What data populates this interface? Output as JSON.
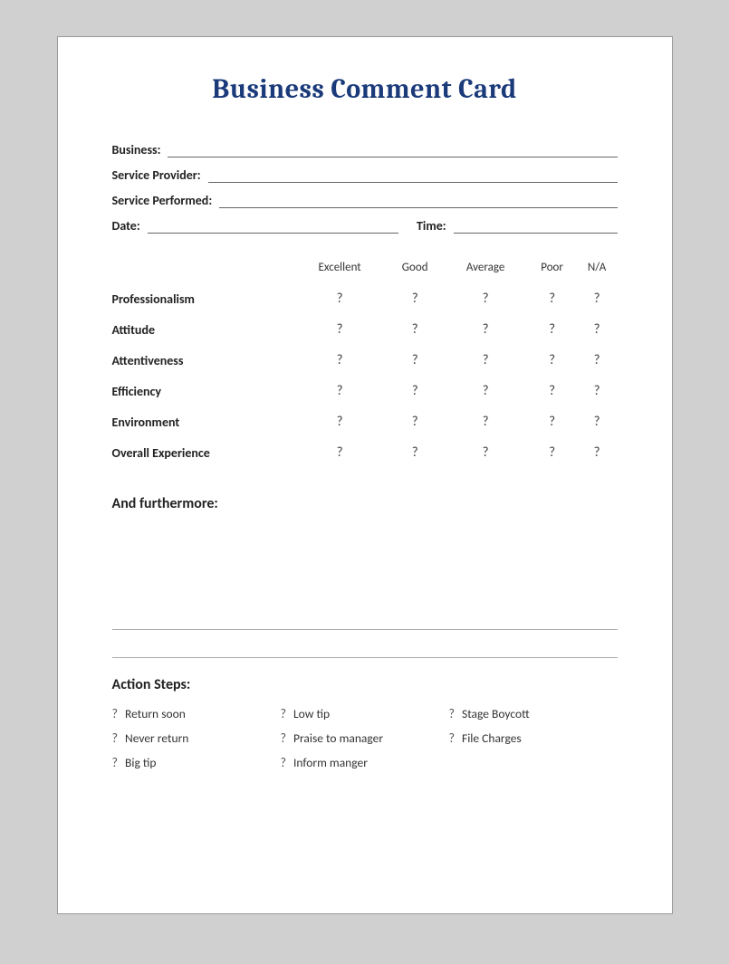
{
  "title": "Business Comment Card",
  "fields": {
    "business_label": "Business:",
    "service_provider_label": "Service Provider:",
    "service_performed_label": "Service Performed:",
    "date_label": "Date:",
    "time_label": "Time:"
  },
  "rating": {
    "columns": [
      "",
      "Excellent",
      "Good",
      "Average",
      "Poor",
      "N/A"
    ],
    "rows": [
      {
        "label": "Professionalism",
        "values": [
          "?",
          "?",
          "?",
          "?",
          "?"
        ]
      },
      {
        "label": "Attitude",
        "values": [
          "?",
          "?",
          "?",
          "?",
          "?"
        ]
      },
      {
        "label": "Attentiveness",
        "values": [
          "?",
          "?",
          "?",
          "?",
          "?"
        ]
      },
      {
        "label": "Efficiency",
        "values": [
          "?",
          "?",
          "?",
          "?",
          "?"
        ]
      },
      {
        "label": "Environment",
        "values": [
          "?",
          "?",
          "?",
          "?",
          "?"
        ]
      },
      {
        "label": "Overall Experience",
        "values": [
          "?",
          "?",
          "?",
          "?",
          "?"
        ]
      }
    ]
  },
  "furthermore_label": "And furthermore:",
  "action_steps_label": "Action Steps:",
  "action_items": [
    {
      "text": "Return soon",
      "col": 0
    },
    {
      "text": "Never return",
      "col": 0
    },
    {
      "text": "Big tip",
      "col": 0
    },
    {
      "text": "Low tip",
      "col": 1
    },
    {
      "text": "Praise to manager",
      "col": 1
    },
    {
      "text": "Inform manger",
      "col": 1
    },
    {
      "text": "Stage Boycott",
      "col": 2
    },
    {
      "text": "File Charges",
      "col": 2
    }
  ]
}
